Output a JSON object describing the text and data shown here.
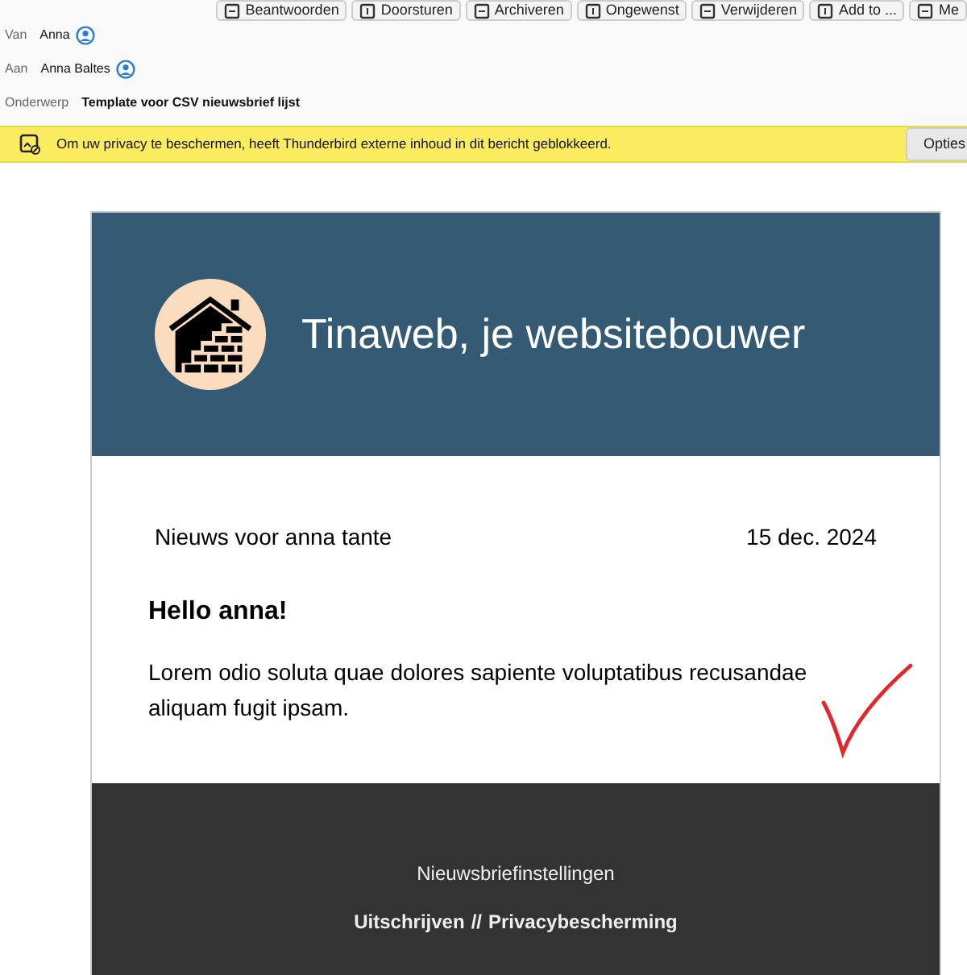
{
  "toolbar": {
    "buttons": [
      "Beantwoorden",
      "Doorsturen",
      "Archiveren",
      "Ongewenst",
      "Verwijderen",
      "Add to ...",
      "Me"
    ]
  },
  "headers": [
    {
      "label": "Van",
      "value": "Anna",
      "contact": true
    },
    {
      "label": "Aan",
      "value": "Anna Baltes",
      "contact": true
    },
    {
      "label": "Onderwerp",
      "value": "Template voor CSV nieuwsbrief lijst",
      "contact": false
    }
  ],
  "notice": {
    "text": "Om uw privacy te beschermen, heeft Thunderbird externe inhoud in dit bericht geblokkeerd.",
    "button": "Opties"
  },
  "email": {
    "brand": "Tinaweb, je websitebouwer",
    "intro": "Nieuws voor anna tante",
    "date": "15 dec. 2024",
    "greeting": "Hello anna!",
    "body": "Lorem odio soluta quae dolores sapiente voluptatibus recusandae aliquam fugit ipsam.",
    "footer": {
      "settings": "Nieuwsbriefinstellingen",
      "unsubscribe": "Uitschrijven",
      "separator": "//",
      "privacy": "Privacybescherming"
    }
  }
}
